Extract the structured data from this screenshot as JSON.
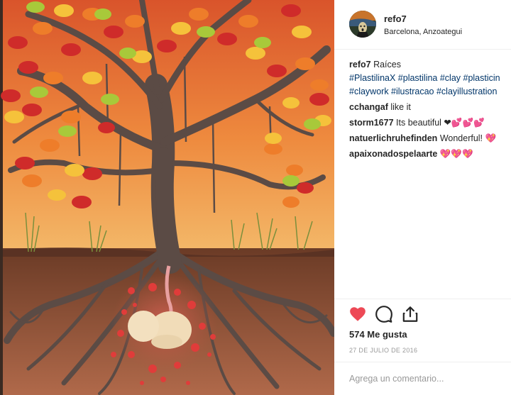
{
  "post": {
    "photo_icon": "clay-tree-fetus-artwork",
    "author": {
      "username": "refo7",
      "location": "Barcelona, Anzoategui",
      "avatar_icon": "avatar-painting"
    },
    "caption": {
      "username": "refo7",
      "text": "Raíces",
      "hashtags_line1": "#PlastilinaX #plastilina #clay #plasticin",
      "hashtags_line2": "#claywork #ilustracao #clayillustration"
    },
    "comments": [
      {
        "username": "cchangaf",
        "text": "like it"
      },
      {
        "username": "storm1677",
        "text": "Its beautiful ❤💕💕💕"
      },
      {
        "username": "natuerlichruhefinden",
        "text": "Wonderful! 💖"
      },
      {
        "username": "apaixonadospelaarte",
        "text": "💖💖💖"
      }
    ],
    "actions": {
      "like_icon": "heart-filled-icon",
      "comment_icon": "comment-bubble-icon",
      "share_icon": "share-icon",
      "like_color": "#ed4956"
    },
    "likes": "574 Me gusta",
    "date": "27 DE JULIO DE 2016",
    "comment_box": {
      "placeholder": "Agrega un comentario..."
    }
  }
}
